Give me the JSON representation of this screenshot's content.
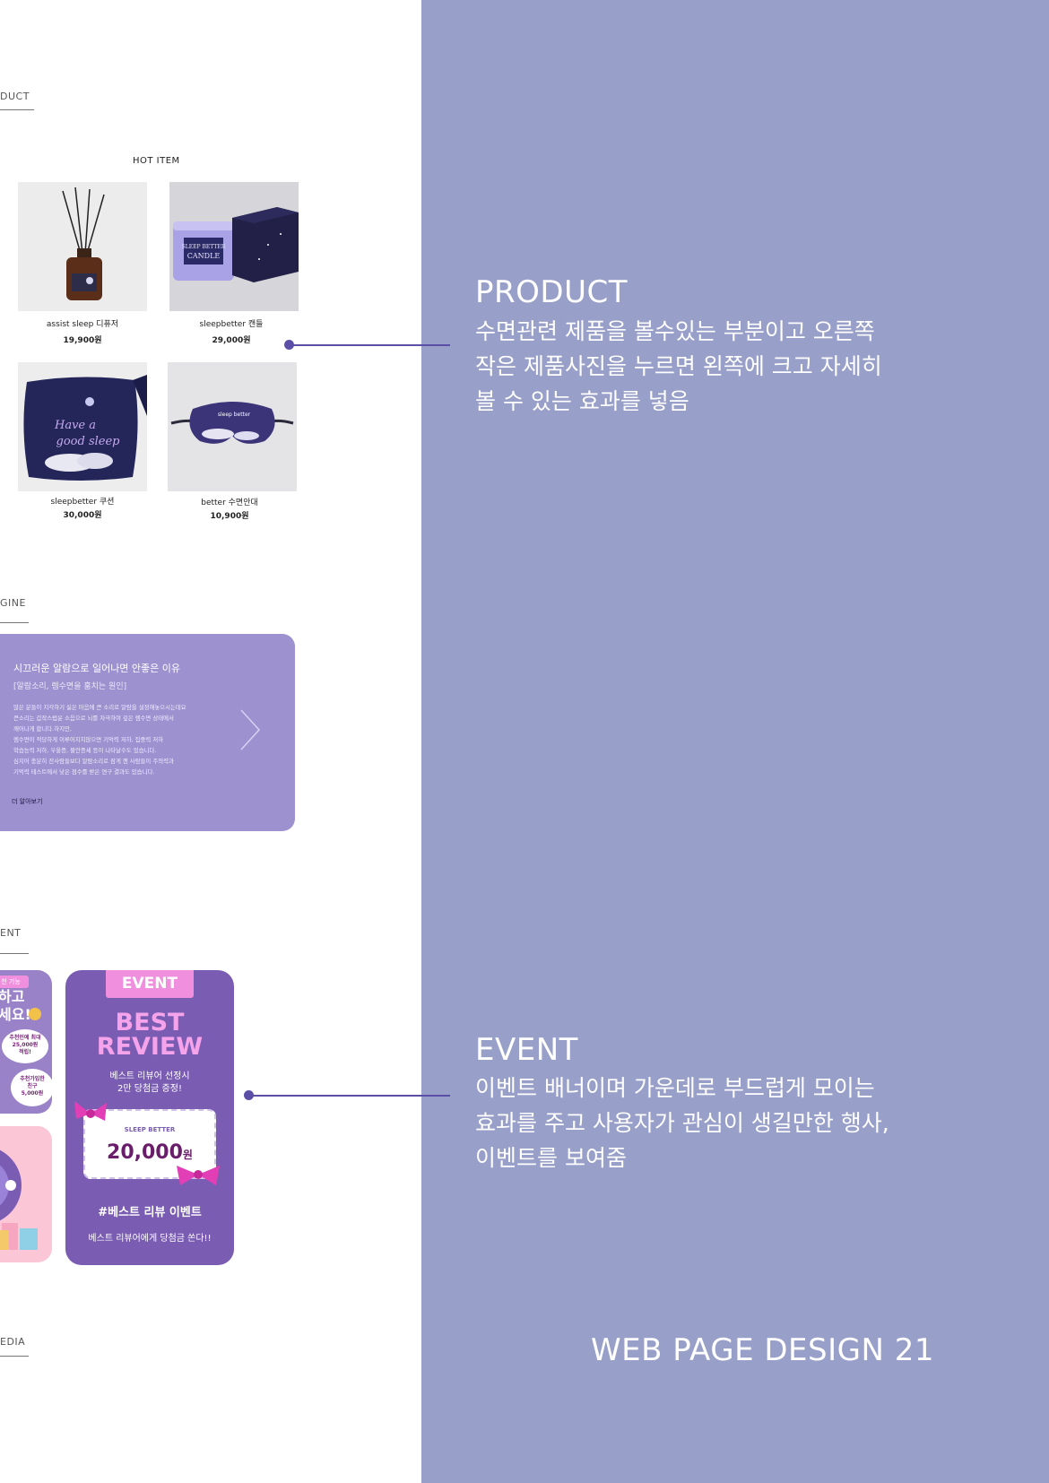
{
  "left": {
    "sections": {
      "product_label": "DUCT",
      "magazine_label": "GINE",
      "event_label": "ENT",
      "media_label": "EDIA"
    },
    "hot_item": "HOT  ITEM",
    "products": [
      {
        "name": "assist sleep 디퓨저",
        "price": "19,900원"
      },
      {
        "name": "sleepbetter 캔들",
        "price": "29,000원"
      },
      {
        "name": "sleepbetter 쿠션",
        "price": "30,000원"
      },
      {
        "name": "better 수면안대",
        "price": "10,900원"
      }
    ],
    "product_images": {
      "candle_label_line1": "SLEEP BETTER",
      "candle_label_line2": "CANDLE",
      "pillow_text_line1": "Have a",
      "pillow_text_line2": "good sleep",
      "mask_brand": "sleep better"
    },
    "magazine": {
      "title": "시끄러운 알람으로 일어나면 안좋은 이유",
      "subtitle": "[알람소리, 렘수면을 훔치는 원인]",
      "body": [
        "많은 분들이 지각하기 싫은 마음에 큰 소리로 알람을 설정해놓으시는데요",
        "큰소리는 갑작스럽운 소음으로 뇌를 자극하여 깊은 렘수면 상태에서",
        "깨어나게 합니다.하지만,",
        "렘수면이 적당하게 이루어지지않으면 기억력 저하, 집중력 저하",
        "학습능력 저하, 우울증, 불안증세 등이 나타날수도 있습니다.",
        "심지어 충분히 잔사람들보다 알람소리로 잠게 깬 사람들이 주의력과",
        "기억력 테스트에서 낮은 점수를 받은 연구 결과도 있습니다."
      ],
      "more": "더 알아보기"
    },
    "event_card_partial": {
      "top_text1": "하고",
      "top_text2": "세요!",
      "badge1_line1": "추천인에 최대",
      "badge1_line2": "25,000원",
      "badge1_line3": "적립!",
      "badge2_line1": "추천가입한",
      "badge2_line2": "친구",
      "badge2_line3": "5,000원",
      "tag": "천 기능"
    },
    "event_card": {
      "tag": "EVENT",
      "best_line1": "BEST",
      "best_line2": "REVIEW",
      "selection_line1": "베스트 리뷰어 선정시",
      "selection_line2": "2만 당첨금 증정!",
      "coupon_brand": "SLEEP BETTER",
      "coupon_amount": "20,000",
      "coupon_unit": "원",
      "hashtag": "#베스트 리뷰 이벤트",
      "footer": "베스트 리뷰어에게 당첨금 쏜다!!"
    }
  },
  "right": {
    "product": {
      "heading": "PRODUCT",
      "lines": [
        "수면관련 제품을 볼수있는 부분이고 오른쪽",
        "작은 제품사진을 누르면 왼쪽에 크고 자세히",
        "볼 수 있는 효과를 넣음"
      ]
    },
    "event": {
      "heading": "EVENT",
      "lines": [
        "이벤트 배너이며 가운데로 부드럽게 모이는",
        "효과를 주고 사용자가 관심이 생길만한 행사,",
        "이벤트를 보여줌"
      ]
    },
    "footer_title": "WEB PAGE DESIGN 21"
  },
  "colors": {
    "panel": "#989fc8",
    "magazine_card": "#9d91d0",
    "event_card": "#7a5cb3",
    "connector": "#5a4ea6",
    "accent_pink": "#f08fdd"
  }
}
